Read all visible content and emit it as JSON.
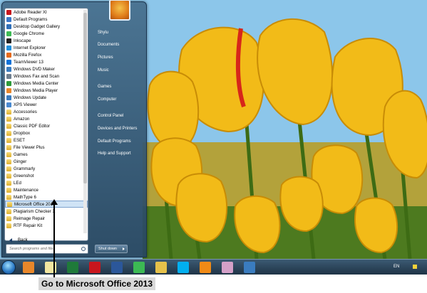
{
  "start_menu": {
    "programs": [
      {
        "label": "Adobe Reader XI",
        "icon": "adobe-reader-icon",
        "color": "#c8161d"
      },
      {
        "label": "Default Programs",
        "icon": "default-programs-icon",
        "color": "#3a78c8"
      },
      {
        "label": "Desktop Gadget Gallery",
        "icon": "gadget-gallery-icon",
        "color": "#2f6fb8"
      },
      {
        "label": "Google Chrome",
        "icon": "chrome-icon",
        "color": "#3cba54"
      },
      {
        "label": "Inkscape",
        "icon": "inkscape-icon",
        "color": "#222222"
      },
      {
        "label": "Internet Explorer",
        "icon": "internet-explorer-icon",
        "color": "#1f8fdc"
      },
      {
        "label": "Mozilla Firefox",
        "icon": "firefox-icon",
        "color": "#e66a1a"
      },
      {
        "label": "TeamViewer 13",
        "icon": "teamviewer-icon",
        "color": "#0e72d8"
      },
      {
        "label": "Windows DVD Maker",
        "icon": "dvd-maker-icon",
        "color": "#3a7cbf"
      },
      {
        "label": "Windows Fax and Scan",
        "icon": "fax-scan-icon",
        "color": "#6f7f8f"
      },
      {
        "label": "Windows Media Center",
        "icon": "media-center-icon",
        "color": "#2e9a3a"
      },
      {
        "label": "Windows Media Player",
        "icon": "media-player-icon",
        "color": "#e8872a"
      },
      {
        "label": "Windows Update",
        "icon": "windows-update-icon",
        "color": "#3a7cbf"
      },
      {
        "label": "XPS Viewer",
        "icon": "xps-viewer-icon",
        "color": "#4a8ad0"
      },
      {
        "label": "Accessories",
        "icon": "folder-icon",
        "folder": true
      },
      {
        "label": "Amazon",
        "icon": "folder-icon",
        "folder": true
      },
      {
        "label": "Classic PDF Editor",
        "icon": "folder-icon",
        "folder": true
      },
      {
        "label": "Dropbox",
        "icon": "folder-icon",
        "folder": true
      },
      {
        "label": "ESET",
        "icon": "folder-icon",
        "folder": true
      },
      {
        "label": "File Viewer Plus",
        "icon": "folder-icon",
        "folder": true
      },
      {
        "label": "Games",
        "icon": "folder-icon",
        "folder": true
      },
      {
        "label": "Ginger",
        "icon": "folder-icon",
        "folder": true
      },
      {
        "label": "Grammarly",
        "icon": "folder-icon",
        "folder": true
      },
      {
        "label": "Greenshot",
        "icon": "folder-icon",
        "folder": true
      },
      {
        "label": "LEd",
        "icon": "folder-icon",
        "folder": true
      },
      {
        "label": "Maintenance",
        "icon": "folder-icon",
        "folder": true
      },
      {
        "label": "MathType 6",
        "icon": "folder-icon",
        "folder": true
      },
      {
        "label": "Microsoft Office 2013",
        "icon": "folder-icon",
        "folder": true,
        "selected": true
      },
      {
        "label": "Plagiarism Checker X",
        "icon": "folder-icon",
        "folder": true
      },
      {
        "label": "Reimage Repair",
        "icon": "folder-icon",
        "folder": true
      },
      {
        "label": "RTF Repair Kit",
        "icon": "folder-icon",
        "folder": true
      }
    ],
    "back_label": "Back",
    "search_placeholder": "Search programs and files",
    "right_items": [
      {
        "label": "Shylu"
      },
      {
        "label": "Documents"
      },
      {
        "label": "Pictures"
      },
      {
        "label": "Music"
      },
      {
        "label": "Games",
        "sep": true
      },
      {
        "label": "Computer"
      },
      {
        "label": "Control Panel",
        "sep": true
      },
      {
        "label": "Devices and Printers"
      },
      {
        "label": "Default Programs"
      },
      {
        "label": "Help and Support"
      }
    ],
    "shutdown_label": "Shut down"
  },
  "taskbar": {
    "icons": [
      {
        "name": "media-player-taskbar-icon",
        "color": "#e8872a"
      },
      {
        "name": "notepad-taskbar-icon",
        "color": "#f2e6a0"
      },
      {
        "name": "excel-taskbar-icon",
        "color": "#1f7a3a"
      },
      {
        "name": "red-app-taskbar-icon",
        "color": "#c8161d"
      },
      {
        "name": "word-taskbar-icon",
        "color": "#2b579a"
      },
      {
        "name": "chrome-taskbar-icon",
        "color": "#3cba54"
      },
      {
        "name": "folder-taskbar-icon",
        "color": "#e5c14a"
      },
      {
        "name": "skype-taskbar-icon",
        "color": "#00aff0"
      },
      {
        "name": "vlc-taskbar-icon",
        "color": "#f08a16"
      },
      {
        "name": "paint-taskbar-icon",
        "color": "#d4a0c8"
      },
      {
        "name": "network-taskbar-icon",
        "color": "#3a7cbf"
      }
    ],
    "language": "EN"
  },
  "caption": "Go to Microsoft Office 2013"
}
